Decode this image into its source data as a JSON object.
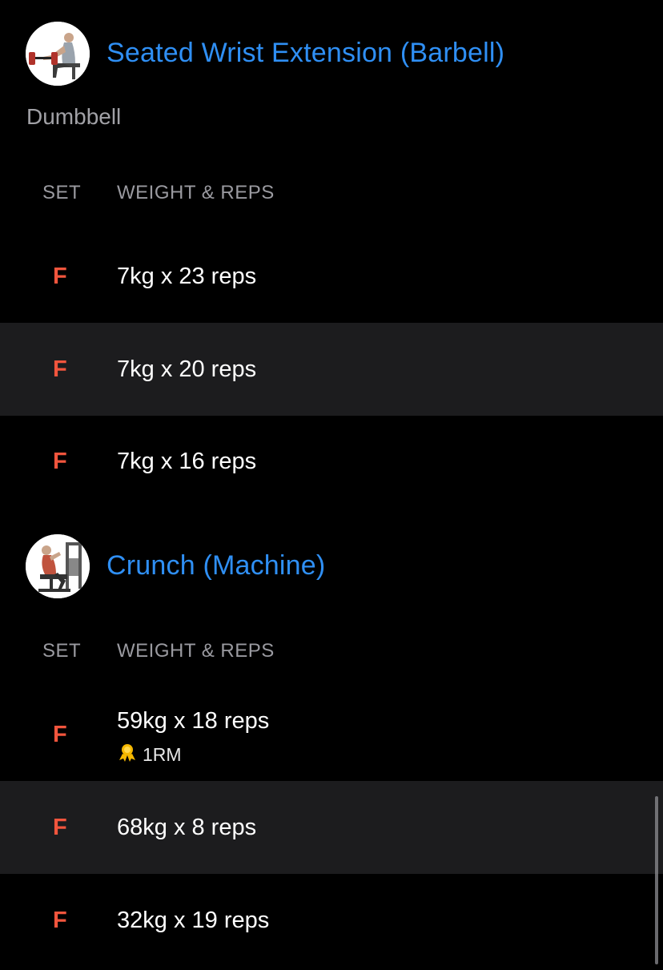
{
  "exercises": [
    {
      "title": "Seated Wrist Extension (Barbell)",
      "note": "Dumbbell",
      "thumbnail_icon": "seated-wrist-extension-illustration",
      "columns": {
        "set": "SET",
        "weight_reps": "WEIGHT & REPS"
      },
      "sets": [
        {
          "label": "F",
          "value": "7kg x 23 reps"
        },
        {
          "label": "F",
          "value": "7kg x 20 reps"
        },
        {
          "label": "F",
          "value": "7kg x 16 reps"
        }
      ]
    },
    {
      "title": "Crunch (Machine)",
      "thumbnail_icon": "machine-crunch-illustration",
      "columns": {
        "set": "SET",
        "weight_reps": "WEIGHT & REPS"
      },
      "sets": [
        {
          "label": "F",
          "value": "59kg x 18 reps",
          "badge": "1RM",
          "badge_icon": "medal-icon"
        },
        {
          "label": "F",
          "value": "68kg x 8 reps"
        },
        {
          "label": "F",
          "value": "32kg x 19 reps"
        }
      ]
    }
  ],
  "colors": {
    "background": "#000000",
    "row_alt": "#1c1c1e",
    "title_blue": "#2f8ff4",
    "set_label_red": "#f1553d",
    "muted_text": "#9a9aa0",
    "medal_gold": "#f5b800"
  }
}
